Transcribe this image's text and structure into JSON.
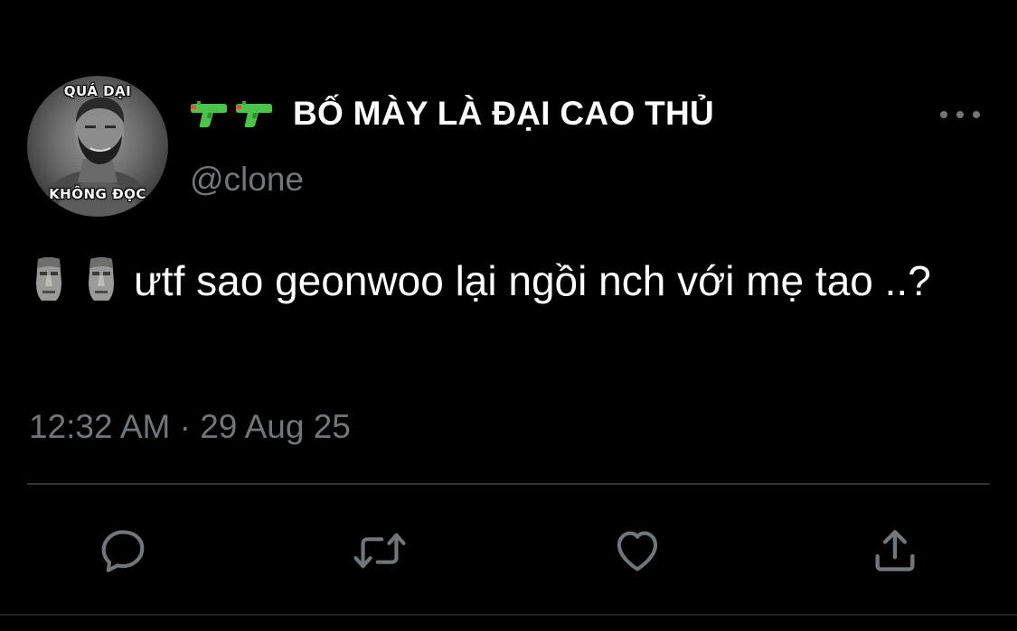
{
  "tweet": {
    "avatar": {
      "caption_top": "QUÁ DẠI",
      "caption_bottom": "KHÔNG ĐỌC"
    },
    "author": {
      "emoji_prefix": "water-pistol-icon x2",
      "display_name": "BỐ MÀY LÀ ĐẠI CAO THỦ",
      "handle": "@clone"
    },
    "text": "ưtf sao geonwoo lại ngồi nch với mẹ tao ..?",
    "text_emoji_prefix": "moai-icon x2",
    "timestamp": "12:32 AM · 29 Aug 25",
    "actions": [
      "reply-icon",
      "retweet-icon",
      "like-icon",
      "share-icon"
    ],
    "colors": {
      "background": "#000000",
      "primary_text": "#ffffff",
      "secondary_text": "#71767b",
      "divider": "#2f3336",
      "gun_green": "#4cc34a"
    }
  }
}
